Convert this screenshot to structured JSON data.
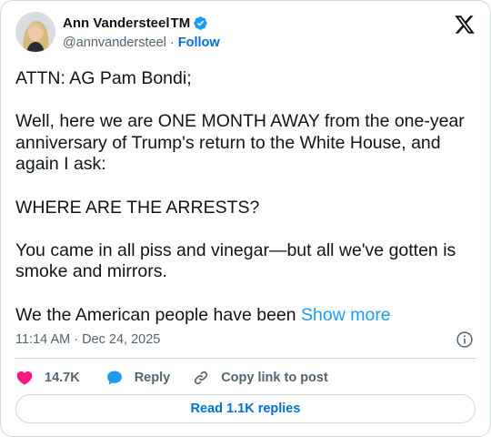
{
  "author": {
    "display_name": "Ann Vandersteel",
    "tm": "TM",
    "handle": "@annvandersteel",
    "separator": "·",
    "follow_label": "Follow"
  },
  "tweet": {
    "paragraphs": [
      "ATTN: AG Pam Bondi;",
      "Well, here we are ONE MONTH AWAY from the one-year anniversary of Trump's return to the White House, and again I ask:",
      "WHERE ARE THE ARRESTS?",
      "You came in all piss and vinegar—but all we've gotten is smoke and mirrors."
    ],
    "last_paragraph": "We the American people have been",
    "show_more_label": "Show more"
  },
  "meta": {
    "timestamp": "11:14 AM · Dec 24, 2025"
  },
  "actions": {
    "likes_count": "14.7K",
    "reply_label": "Reply",
    "copy_link_label": "Copy link to post"
  },
  "read_replies_label": "Read 1.1K replies",
  "colors": {
    "heart": "#f91880",
    "reply_bubble": "#1d9bf0",
    "link_blue": "#006fd6",
    "verified_blue": "#1d9bf0",
    "muted_text": "#536471",
    "border": "#cfd9de"
  },
  "icons": [
    "verified-badge-icon",
    "x-logo-icon",
    "info-icon",
    "heart-icon",
    "reply-bubble-icon",
    "link-icon"
  ]
}
